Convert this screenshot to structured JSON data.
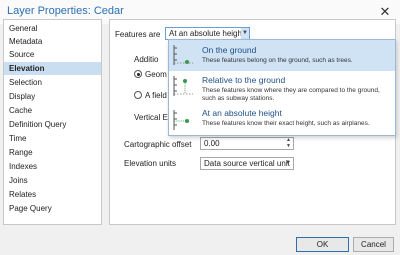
{
  "window": {
    "title": "Layer Properties: Cedar",
    "close_glyph": "✕"
  },
  "nav": {
    "items": [
      {
        "label": "General"
      },
      {
        "label": "Metadata"
      },
      {
        "label": "Source"
      },
      {
        "label": "Elevation",
        "selected": true
      },
      {
        "label": "Selection"
      },
      {
        "label": "Display"
      },
      {
        "label": "Cache"
      },
      {
        "label": "Definition Query"
      },
      {
        "label": "Time"
      },
      {
        "label": "Range"
      },
      {
        "label": "Indexes"
      },
      {
        "label": "Joins"
      },
      {
        "label": "Relates"
      },
      {
        "label": "Page Query"
      }
    ]
  },
  "elevation": {
    "features_are_label": "Features are",
    "features_are_value": "At an absolute height",
    "additional_label": "Additio",
    "radio_geometry_label": "Geom",
    "radio_field_label": "A field",
    "vertical_label": "Vertical E",
    "cartographic_offset_label": "Cartographic offset",
    "cartographic_offset_value": "0.00",
    "elevation_units_label": "Elevation units",
    "elevation_units_value": "Data source vertical unit"
  },
  "dropdown": {
    "options": [
      {
        "title": "On the ground",
        "description": "These features belong on the ground, such as trees.",
        "icon": "on-ground-icon",
        "highlighted": true
      },
      {
        "title": "Relative to the ground",
        "description": "These features know where they are compared to the ground, such as subway stations.",
        "icon": "relative-ground-icon"
      },
      {
        "title": "At an absolute height",
        "description": "These features know their exact height, such as airplanes.",
        "icon": "absolute-height-icon"
      }
    ]
  },
  "buttons": {
    "ok": "OK",
    "cancel": "Cancel"
  },
  "colors": {
    "accent": "#2a6fb0",
    "selection": "#c9dff1",
    "icon_green": "#3a9a4a"
  }
}
